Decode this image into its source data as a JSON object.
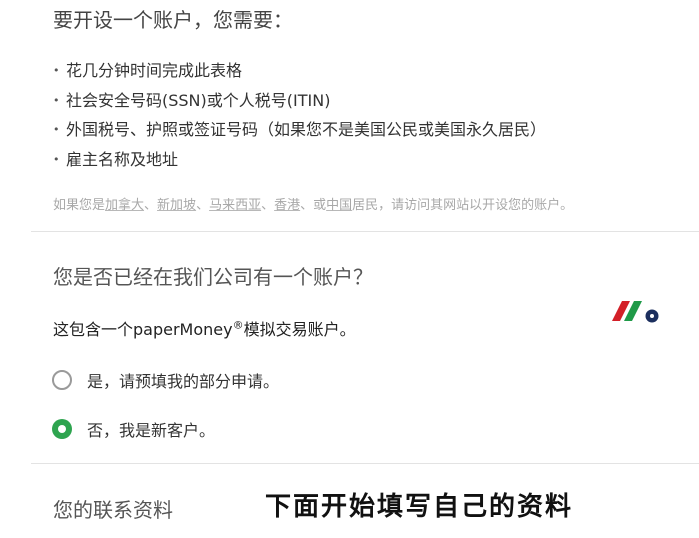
{
  "requirements": {
    "title": "要开设一个账户，您需要：",
    "items": [
      "花几分钟时间完成此表格",
      "社会安全号码(SSN)或个人税号(ITIN)",
      "外国税号、护照或签证号码（如果您不是美国公民或美国永久居民）",
      "雇主名称及地址"
    ],
    "note": {
      "prefix": "如果您是",
      "links": [
        "加拿大",
        "新加坡",
        "马来西亚",
        "香港"
      ],
      "sep": "、",
      "or": "或",
      "china": "中国",
      "suffix": "居民，请访问其网站以开设您的账户。"
    }
  },
  "existing_account": {
    "question": "您是否已经在我们公司有一个账户？",
    "desc_prefix": "这包含一个paperMoney",
    "desc_reg": "®",
    "desc_suffix": "模拟交易账户。",
    "options": [
      {
        "label": "是，请预填我的部分申请。",
        "selected": false
      },
      {
        "label": "否，我是新客户。",
        "selected": true
      }
    ]
  },
  "contact": {
    "title": "您的联系资料"
  },
  "overlay_caption": "下面开始填写自己的资料",
  "colors": {
    "radio_selected": "#2ea44f",
    "logo_red": "#d32028",
    "logo_green": "#1f9a48",
    "logo_navy": "#1c2f5e"
  }
}
